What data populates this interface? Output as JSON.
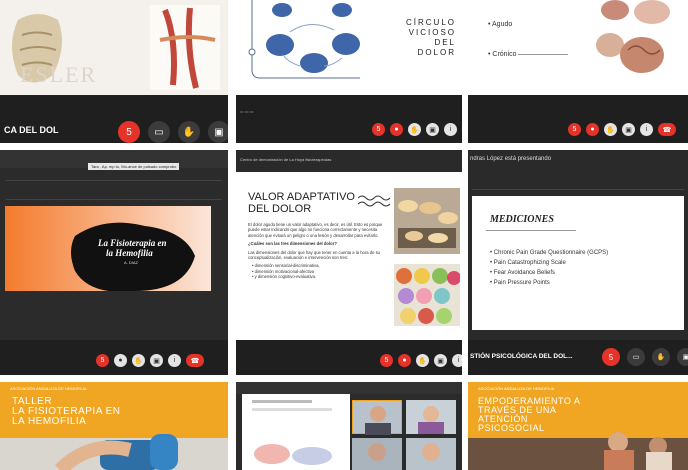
{
  "tiles": {
    "t1": {
      "title": "CA DEL DOL",
      "watermark": "ESLER"
    },
    "t2": {
      "diagram_title_lines": [
        "CÍRCULO",
        "VICIOSO DEL",
        "DOLOR"
      ]
    },
    "t3": {
      "items": [
        "Agudo",
        "Crónico"
      ]
    },
    "t4": {
      "tooltip": "Tara , Ap. mp to, Mo-ance  de  pulsado  comprobo",
      "slide_title_line1": "La Fisioterapia en",
      "slide_title_line2": "la Hemofilia",
      "slide_sub": "A. DIAZ"
    },
    "t5": {
      "header_text": "Centro de demostración de La Hoya fisioterapeutas",
      "title_line1": "VALOR ADAPTATIVO",
      "title_line2": "DEL DOLOR",
      "para1": "El dolor agudo tiene un valor adaptativo, es decir, es útil. Esto es porque puede estar indicando que algo no funciona correctamente y necesita atención que evitará un peligro o una lesión y desarrollar para evitarlo.",
      "question": "¿Cuáles son las tres dimensiones del dolor?",
      "para2": "Las dimensiones del dolor que hay que tener en cuenta a la hora de su conceptualización, evaluación e intervención son tres:",
      "bullets": [
        "dimensión sensorial-discriminativa,",
        "dimensión motivacional-afectiva",
        "y dimensión cognitivo-evaluativa."
      ]
    },
    "t6": {
      "presenter_text": "ndras López está presentando",
      "slide_title": "MEDICIONES",
      "bullets": [
        "Chronic Pain Grade Questionnaire (GCPS)",
        "Pain Catastrophizing Scale",
        "Fear Avoidance Beliefs",
        "Pain Pressure Points"
      ],
      "bottom_title": "STIÓN PSICOLÓGICA DEL DOL..."
    },
    "t7": {
      "org": "ASOCIACIÓN ANDALUZA DE HEMOFILIA",
      "title_lines": [
        "TALLER",
        "LA FISIOTERAPIA EN",
        "LA HEMOFILIA"
      ]
    },
    "t9": {
      "org": "ASOCIACIÓN ANDALUZA DE HEMOFILIA",
      "title_lines": [
        "EMPODERAMIENTO A",
        "TRAVÉS DE UNA",
        "ATENCIÓN",
        "PSICOSOCIAL"
      ]
    }
  },
  "controls": {
    "count_badge": "5",
    "leave_icon": "phone-hangup-icon",
    "mic_icon": "microphone-icon",
    "camera_icon": "camera-icon",
    "hand_icon": "raise-hand-icon",
    "share_icon": "screen-share-icon"
  },
  "colors": {
    "accent_red": "#e5332a",
    "orange_banner": "#f0a623",
    "dark_bar": "#1f1f1f"
  }
}
